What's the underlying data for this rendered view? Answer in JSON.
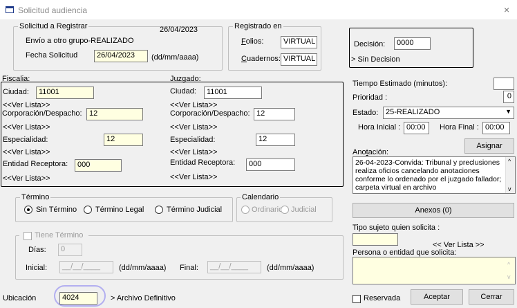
{
  "window": {
    "title": "Solicitud audiencia",
    "close": "×"
  },
  "solicitud": {
    "legend": "Solicitud a Registrar",
    "date": "26/04/2023",
    "envio": "Envío a otro grupo-REALIZADO",
    "fecha_label": "Fecha Solicitud",
    "fecha_value": "26/04/2023",
    "fecha_hint": "(dd/mm/aaaa)"
  },
  "registrado": {
    "legend": "Registrado en",
    "folios_label": "Folios:",
    "folios_value": "VIRTUAL",
    "cuadernos_label": "Cuadernos:",
    "cuadernos_value": "VIRTUAL"
  },
  "decision": {
    "label": "Decisión:",
    "value": "0000",
    "text": "> Sin Decision"
  },
  "fiscalia": {
    "title": "Fiscalia:",
    "ciudad_label": "Ciudad:",
    "ciudad_value": "11001",
    "ver_lista": "<<Ver Lista>>",
    "corp_label": "Corporación/Despacho:",
    "corp_value": "12",
    "esp_label": "Especialidad:",
    "esp_value": "12",
    "entidad_label": "Entidad Receptora:",
    "entidad_value": "000"
  },
  "juzgado": {
    "title": "Juzgado:",
    "ciudad_label": "Ciudad:",
    "ciudad_value": "11001",
    "ver_lista": "<<Ver Lista>>",
    "corp_label": "Corporación/Despacho:",
    "corp_value": "12",
    "esp_label": "Especialidad:",
    "esp_value": "12",
    "entidad_label": "Entidad Receptora:",
    "entidad_value": "000"
  },
  "termino": {
    "legend": "Término",
    "options": [
      "Sin Término",
      "Término Legal",
      "Término Judicial"
    ],
    "selected": "Sin Término"
  },
  "calendario": {
    "legend": "Calendario",
    "options": [
      "Ordinario",
      "Judicial"
    ]
  },
  "tiene_termino": {
    "legend": "Tiene Término",
    "dias_label": "Días:",
    "dias_value": "0",
    "inicial_label": "Inicial:",
    "inicial_value": "__/__/____",
    "hint1": "(dd/mm/aaaa)",
    "final_label": "Final:",
    "final_value": "__/__/____",
    "hint2": "(dd/mm/aaaa)"
  },
  "ubicacion": {
    "label": "Ubicación",
    "value": "4024",
    "text": "> Archivo Definitivo"
  },
  "right": {
    "tiempo_label": "Tiempo Estimado (minutos):",
    "tiempo_value": "",
    "prioridad_label": "Prioridad :",
    "prioridad_value": "0",
    "estado_label": "Estado:",
    "estado_value": "25-REALIZADO",
    "hora_inicial_label": "Hora Inicial :",
    "hora_inicial_value": "00:00",
    "hora_final_label": "Hora Final :",
    "hora_final_value": "00:00",
    "asignar": "Asignar",
    "anotacion_label": "Anotación:",
    "anotacion_text": "26-04-2023-Convida: Tribunal y preclusiones realiza oficios cancelando anotaciones conforme lo ordenado por el juzgado fallador; carpeta virtual en archivo",
    "anexos": "Anexos (0)",
    "tipo_sujeto_label": "Tipo sujeto quien solicita :",
    "tipo_sujeto_value": "",
    "ver_lista": "<< Ver Lista >>",
    "persona_label": "Persona o entidad que solicita:",
    "persona_value": "",
    "reservada": "Reservada",
    "aceptar": "Aceptar",
    "cerrar": "Cerrar"
  }
}
